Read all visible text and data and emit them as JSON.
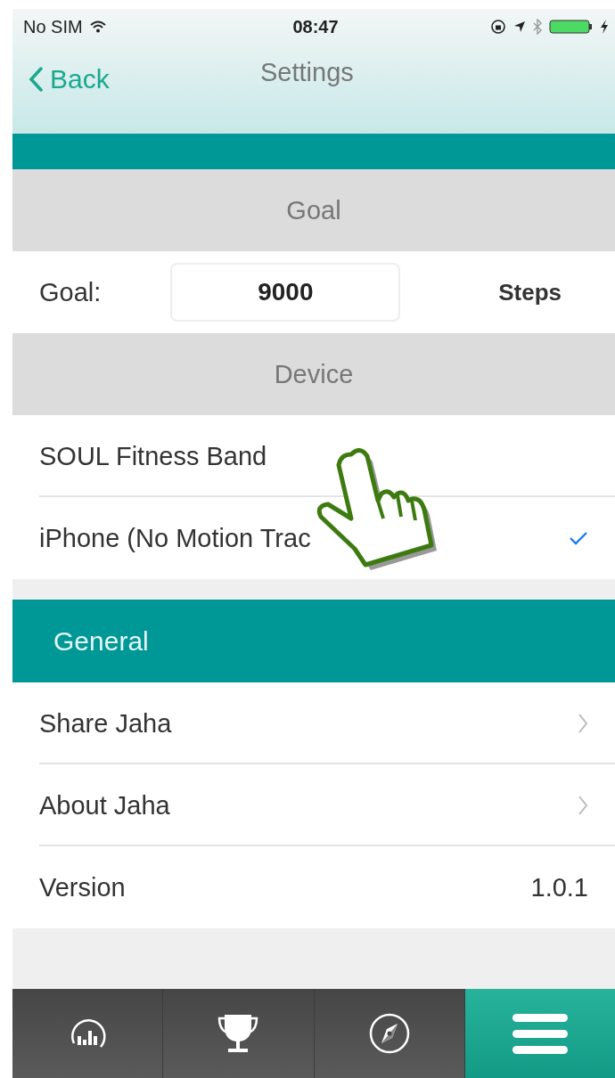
{
  "status_bar": {
    "carrier": "No SIM",
    "time": "08:47"
  },
  "nav": {
    "back": "Back",
    "title": "Settings"
  },
  "sections": [
    {
      "kind": "banner",
      "groups": [
        {
          "header": "Goal",
          "rows": [
            {
              "kind": "goal",
              "label": "Goal:",
              "value": "9000",
              "unit": "Steps"
            }
          ]
        },
        {
          "header": "Device",
          "rows": [
            {
              "kind": "choice",
              "label": "SOUL Fitness Band",
              "checked": false
            },
            {
              "kind": "choice",
              "label": "iPhone (No Motion Trac",
              "checked": true
            }
          ]
        }
      ]
    },
    {
      "kind": "section",
      "title": "General",
      "groups": [
        {
          "rows": [
            {
              "kind": "link",
              "label": "Share Jaha"
            },
            {
              "kind": "link",
              "label": "About Jaha"
            },
            {
              "kind": "value",
              "label": "Version",
              "value": "1.0.1"
            }
          ]
        }
      ]
    }
  ],
  "tabs": [
    {
      "kind": "chart",
      "selected": false
    },
    {
      "kind": "trophy",
      "selected": false
    },
    {
      "kind": "compass",
      "selected": false
    },
    {
      "kind": "menu",
      "selected": true
    }
  ]
}
